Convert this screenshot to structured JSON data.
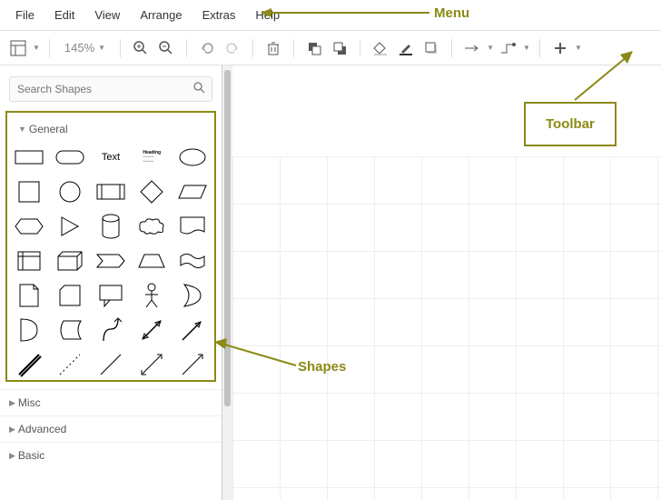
{
  "menu": {
    "items": [
      "File",
      "Edit",
      "View",
      "Arrange",
      "Extras",
      "Help"
    ]
  },
  "toolbar": {
    "zoom": "145%"
  },
  "sidebar": {
    "search_placeholder": "Search Shapes",
    "sections": {
      "general": "General",
      "misc": "Misc",
      "advanced": "Advanced",
      "basic": "Basic"
    },
    "text_shape_label": "Text",
    "heading_shape_label": "Heading"
  },
  "annotations": {
    "menu": "Menu",
    "toolbar": "Toolbar",
    "shapes": "Shapes"
  },
  "colors": {
    "highlight": "#8b8a16"
  }
}
